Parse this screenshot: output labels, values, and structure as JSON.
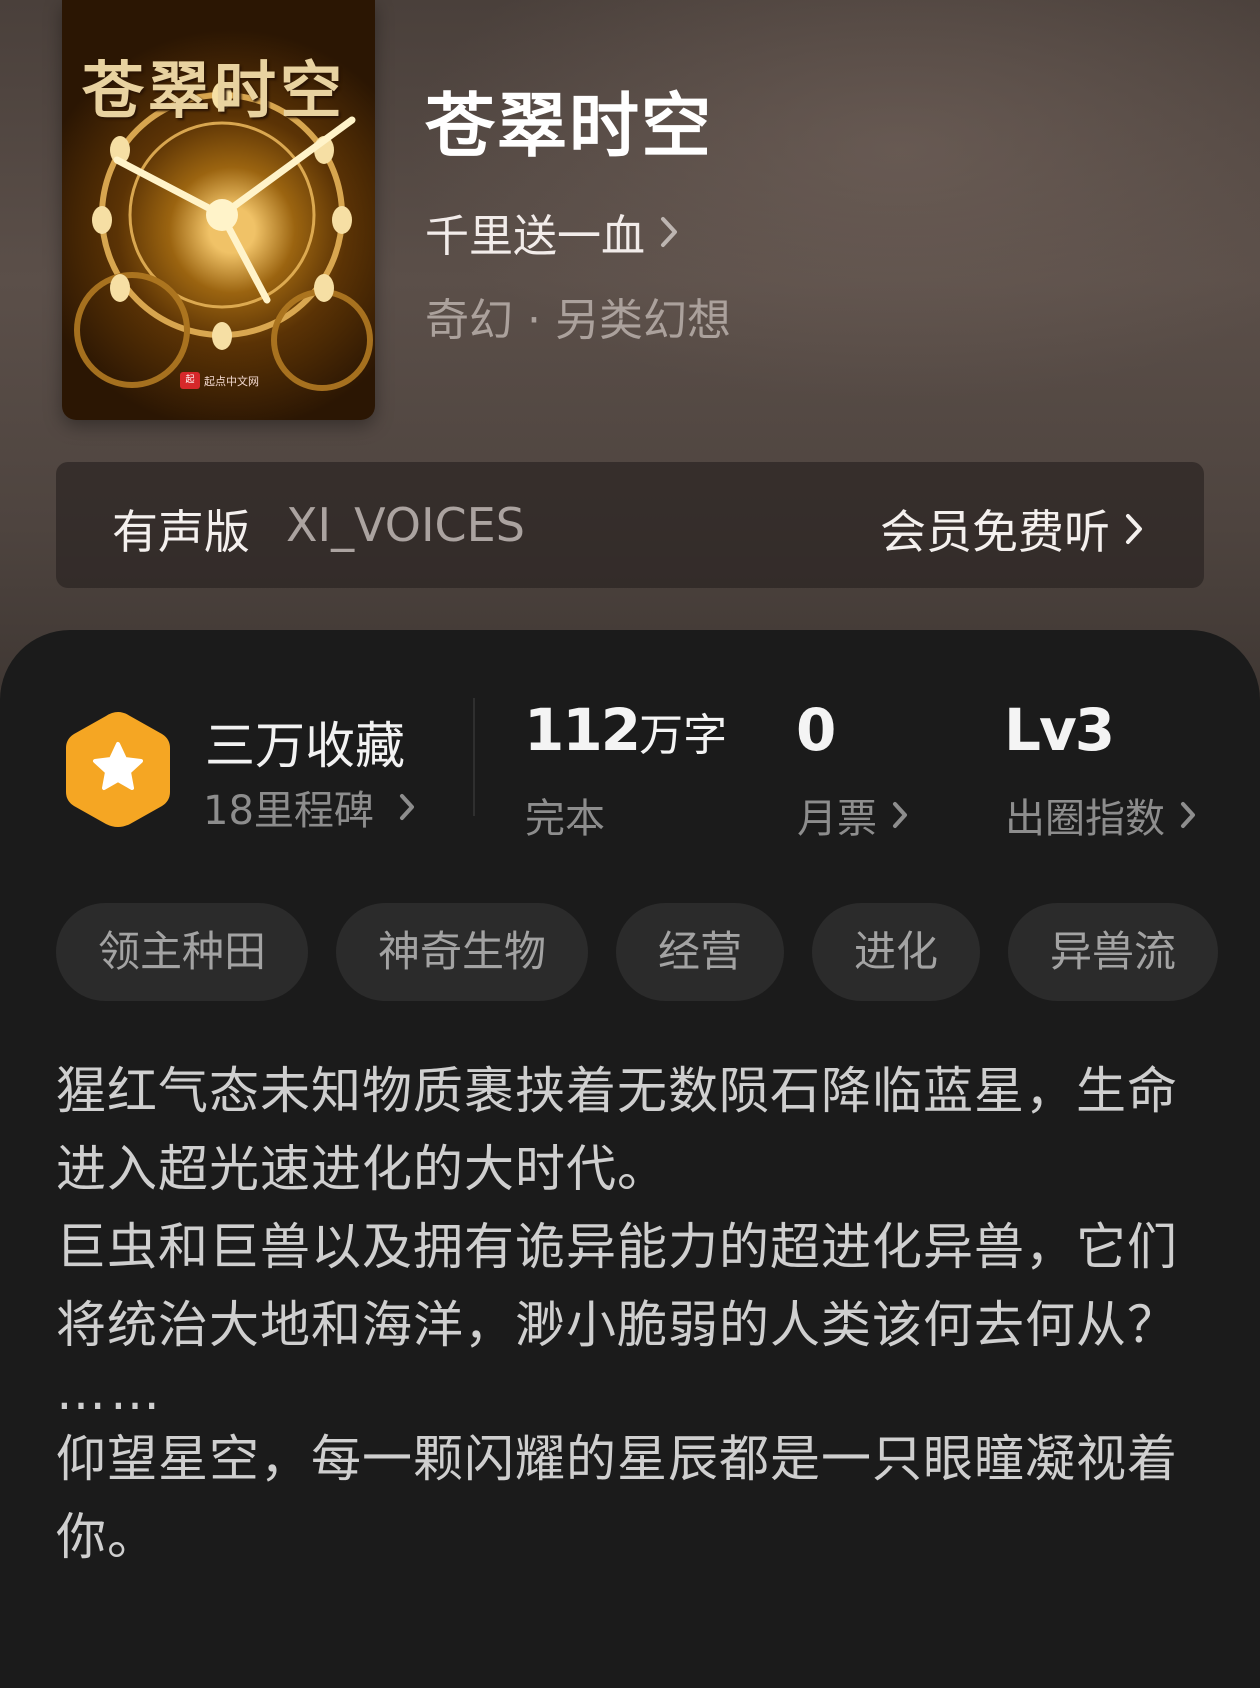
{
  "book": {
    "cover_title": "苍翠时空",
    "cover_publisher": "起点中文网",
    "title": "苍翠时空",
    "author": "千里送一血",
    "genre": "奇幻 · 另类幻想"
  },
  "audio": {
    "label": "有声版",
    "narrator": "XI_VOICES",
    "action": "会员免费听"
  },
  "stats": {
    "collection_title": "三万收藏",
    "collection_sub": "18里程碑",
    "word_count": "112",
    "word_unit": "万字",
    "status": "完本",
    "monthly_tickets": "0",
    "monthly_label": "月票",
    "level": "Lv3",
    "level_label": "出圈指数"
  },
  "tags": [
    "领主种田",
    "神奇生物",
    "经营",
    "进化",
    "异兽流"
  ],
  "synopsis": [
    "猩红气态未知物质裹挟着无数陨石降临蓝星，生命进入超光速进化的大时代。",
    "巨虫和巨兽以及拥有诡异能力的超进化异兽，它们将统治大地和海洋，渺小脆弱的人类该何去何从？",
    "……",
    "仰望星空，每一颗闪耀的星辰都是一只眼瞳凝视着你。"
  ],
  "colors": {
    "badge": "#f5a623",
    "panel": "#1b1b1b",
    "tag_bg": "#2b2b2b"
  }
}
